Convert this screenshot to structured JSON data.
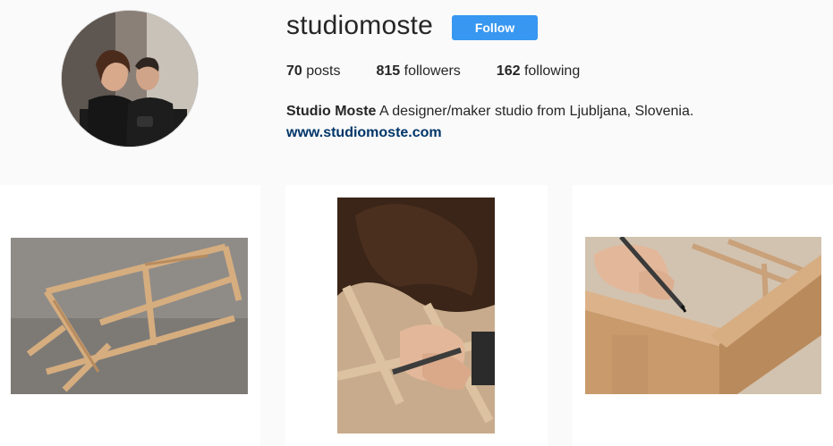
{
  "profile": {
    "username": "studiomoste",
    "follow_label": "Follow",
    "stats": [
      {
        "value": "70",
        "label": "posts"
      },
      {
        "value": "815",
        "label": "followers"
      },
      {
        "value": "162",
        "label": "following"
      }
    ],
    "full_name": "Studio Moste",
    "bio": "A designer/maker studio from Ljubljana, Slovenia.",
    "website": "www.studiomoste.com"
  },
  "colors": {
    "follow_button": "#3897f0",
    "link": "#003569",
    "background": "#fafafa"
  },
  "posts": [
    {
      "icon": "wooden-frame-photo"
    },
    {
      "icon": "craftsman-measuring-photo"
    },
    {
      "icon": "pencil-marking-wood-photo"
    }
  ]
}
